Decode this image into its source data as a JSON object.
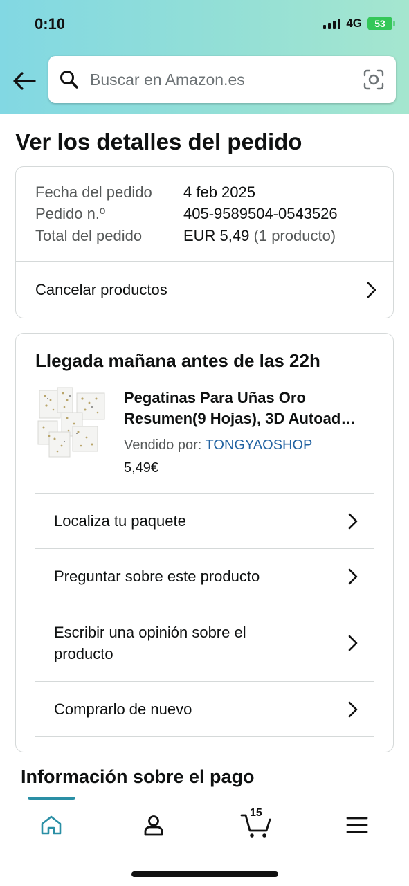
{
  "status_bar": {
    "time": "0:10",
    "network": "4G",
    "battery": "53"
  },
  "search": {
    "placeholder": "Buscar en Amazon.es"
  },
  "page": {
    "title": "Ver los detalles del pedido"
  },
  "order_summary": {
    "date_label": "Fecha del pedido",
    "date_value": "4 feb 2025",
    "number_label": "Pedido n.º",
    "number_value": "405-9589504-0543526",
    "total_label": "Total del pedido",
    "total_value": "EUR 5,49",
    "total_items": "(1 producto)",
    "cancel_label": "Cancelar productos"
  },
  "delivery": {
    "title": "Llegada mañana antes de las 22h",
    "product": {
      "title_line1": "Pegatinas Para Uñas Oro",
      "title_line2": "Resumen(9 Hojas), 3D Autoad…",
      "seller_label": "Vendido por:",
      "seller_name": "TONGYAOSHOP",
      "price": "5,49€"
    },
    "actions": [
      {
        "label": "Localiza tu paquete"
      },
      {
        "label": "Preguntar sobre este producto"
      },
      {
        "label": "Escribir una opinión sobre el producto"
      },
      {
        "label": "Comprarlo de nuevo"
      }
    ]
  },
  "payment_section": {
    "title": "Información sobre el pago"
  },
  "tabbar": {
    "cart_count": "15",
    "accent_color": "#2a8fa5"
  },
  "icons": [
    "back-arrow-icon",
    "search-icon",
    "camera-icon",
    "chevron-right-icon",
    "home-icon",
    "account-icon",
    "cart-icon",
    "menu-icon"
  ]
}
